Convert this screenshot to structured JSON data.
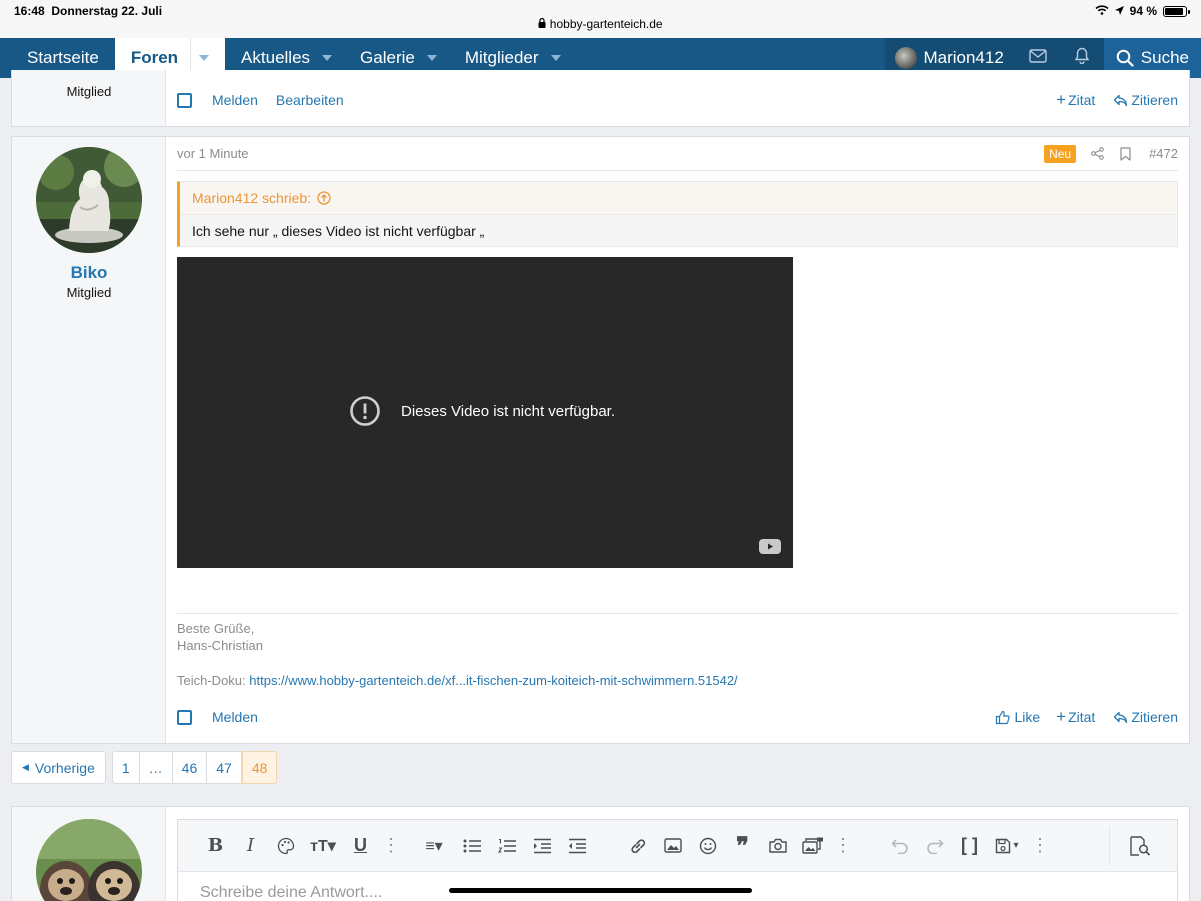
{
  "status_bar": {
    "time": "16:48",
    "date": "Donnerstag 22. Juli",
    "url": "hobby-gartenteich.de",
    "battery": "94 %"
  },
  "nav": {
    "items": [
      {
        "label": "Startseite"
      },
      {
        "label": "Foren"
      },
      {
        "label": "Aktuelles"
      },
      {
        "label": "Galerie"
      },
      {
        "label": "Mitglieder"
      }
    ],
    "user": "Marion412",
    "search": "Suche"
  },
  "prev_post": {
    "usertitle": "Mitglied",
    "actions": {
      "report": "Melden",
      "edit": "Bearbeiten",
      "quote": "Zitat",
      "reply": "Zitieren"
    }
  },
  "post": {
    "username": "Biko",
    "usertitle": "Mitglied",
    "time": "vor 1 Minute",
    "new_badge": "Neu",
    "number": "#472",
    "quote": {
      "author": "Marion412 schrieb:",
      "text": "Ich sehe nur „ dieses Video ist nicht verfügbar „"
    },
    "video_message": "Dieses Video ist nicht verfügbar.",
    "signature": {
      "line1": "Beste Grüße,",
      "line2": "Hans-Christian",
      "doku_label": "Teich-Doku:",
      "doku_link": "https://www.hobby-gartenteich.de/xf...it-fischen-zum-koiteich-mit-schwimmern.51542/"
    },
    "actions": {
      "report": "Melden",
      "like": "Like",
      "quote": "Zitat",
      "reply": "Zitieren"
    }
  },
  "pagination": {
    "prev": "Vorherige",
    "pages": [
      "1",
      "…",
      "46",
      "47",
      "48"
    ],
    "current": "48"
  },
  "editor": {
    "placeholder": "Schreibe deine Antwort...."
  },
  "colors": {
    "nav_bg": "#185886",
    "link": "#2577b1",
    "accent": "#f7a120",
    "video_bg": "#282828"
  }
}
